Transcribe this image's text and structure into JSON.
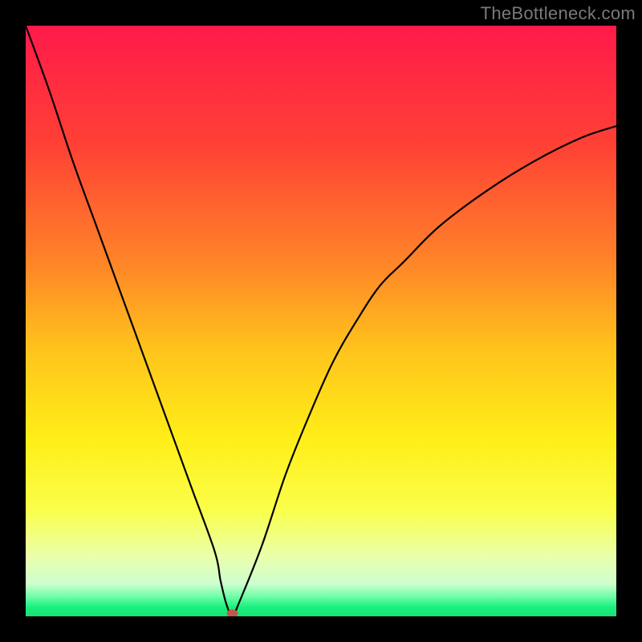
{
  "credit": "TheBottleneck.com",
  "chart_data": {
    "type": "line",
    "title": "",
    "xlabel": "",
    "ylabel": "",
    "xlim": [
      0,
      100
    ],
    "ylim": [
      0,
      100
    ],
    "series": [
      {
        "name": "curve",
        "x": [
          0,
          4,
          8,
          12,
          16,
          20,
          24,
          28,
          32,
          33,
          34,
          35,
          36,
          40,
          44,
          48,
          52,
          56,
          60,
          64,
          70,
          78,
          86,
          94,
          100
        ],
        "values": [
          100,
          89,
          77,
          66,
          55,
          44,
          33,
          22,
          11,
          6,
          2,
          0,
          2,
          12,
          24,
          34,
          43,
          50,
          56,
          60,
          66,
          72,
          77,
          81,
          83
        ]
      }
    ],
    "minimum_marker": {
      "x": 35.0,
      "y": 0.5,
      "color": "#c2554c"
    },
    "gradient_stops": [
      {
        "offset": 0.0,
        "color": "#ff1a4b"
      },
      {
        "offset": 0.2,
        "color": "#ff4035"
      },
      {
        "offset": 0.4,
        "color": "#ff8428"
      },
      {
        "offset": 0.55,
        "color": "#ffc41c"
      },
      {
        "offset": 0.7,
        "color": "#ffee18"
      },
      {
        "offset": 0.82,
        "color": "#faff4a"
      },
      {
        "offset": 0.9,
        "color": "#e9ffad"
      },
      {
        "offset": 0.945,
        "color": "#cdffce"
      },
      {
        "offset": 0.965,
        "color": "#76ffaa"
      },
      {
        "offset": 0.985,
        "color": "#18f07d"
      },
      {
        "offset": 1.0,
        "color": "#18e074"
      }
    ]
  }
}
